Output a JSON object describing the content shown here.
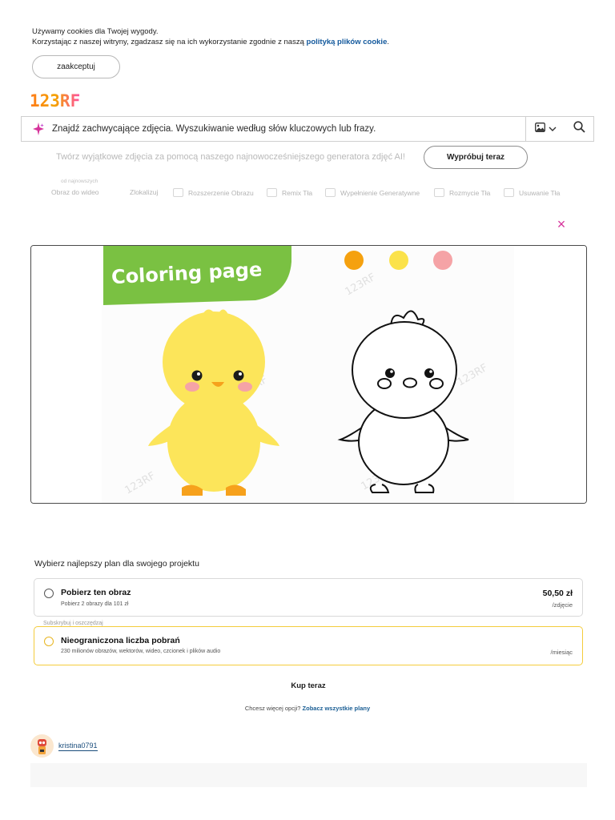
{
  "cookie": {
    "line1": "Używamy cookies dla Twojej wygody.",
    "line2_prefix": "Korzystając z naszej witryny, zgadzasz się na ich wykorzystanie zgodnie z naszą ",
    "policy_link": "polityką plików cookie",
    "line2_suffix": ".",
    "accept_label": "zaakceptuj"
  },
  "logo": {
    "text": "123RF"
  },
  "search": {
    "placeholder": "Znajdź zachwycające zdjęcia. Wyszukiwanie według słów kluczowych lub frazy.",
    "icons": [
      "sparkle-icon",
      "image-search-icon",
      "chevron-down-icon",
      "search-icon"
    ]
  },
  "ai_banner": {
    "text": "Twórz wyjątkowe zdjęcia za pomocą naszego najnowocześniejszego generatora zdjęć AI!",
    "button_label": "Wypróbuj teraz"
  },
  "tools": {
    "small_label": "od najnowszych",
    "items": [
      {
        "label": "Obraz do wideo"
      },
      {
        "label": "Zlokalizuj"
      },
      {
        "label": "Rozszerzenie Obrazu"
      },
      {
        "label": "Remix Tła"
      },
      {
        "label": "Wypełnienie Generatywne"
      },
      {
        "label": "Rozmycie Tła"
      },
      {
        "label": "Usuwanie Tła"
      }
    ]
  },
  "preview": {
    "close_symbol": "×",
    "image_heading": "Coloring page",
    "watermark": "123RF",
    "colors": {
      "green_banner": "#7ac142",
      "chick_yellow": "#fce55a",
      "feet_orange": "#f6a11c",
      "dot_orange": "#f5a10f",
      "dot_yellow": "#fbe24a",
      "dot_pink": "#f5a3a6",
      "cheek_pink": "#f5a3a6"
    }
  },
  "plans": {
    "title": "Wybierz najlepszy plan dla swojego projektu",
    "subscribe_label": "Subskrybuj i oszczędzaj",
    "options": [
      {
        "name": "Pobierz ten obraz",
        "sub": "Pobierz 2 obrazy dla 101 zł",
        "price": "50,50 zł",
        "unit": "/zdjęcie",
        "selected": false
      },
      {
        "name": "Nieograniczona liczba pobrań",
        "sub": "230 milionów obrazów, wektorów, wideo, czcionek i plików audio",
        "price": "",
        "unit": "/miesiąc",
        "selected": false
      }
    ],
    "buy_label": "Kup teraz",
    "more_prefix": "Chcesz więcej opcji? ",
    "more_link": "Zobacz wszystkie plany"
  },
  "author": {
    "name": "kristina0791"
  },
  "theme": {
    "accent_pink": "#d6339b",
    "link_blue": "#12589c",
    "highlight_yellow": "#f4cc3c"
  }
}
